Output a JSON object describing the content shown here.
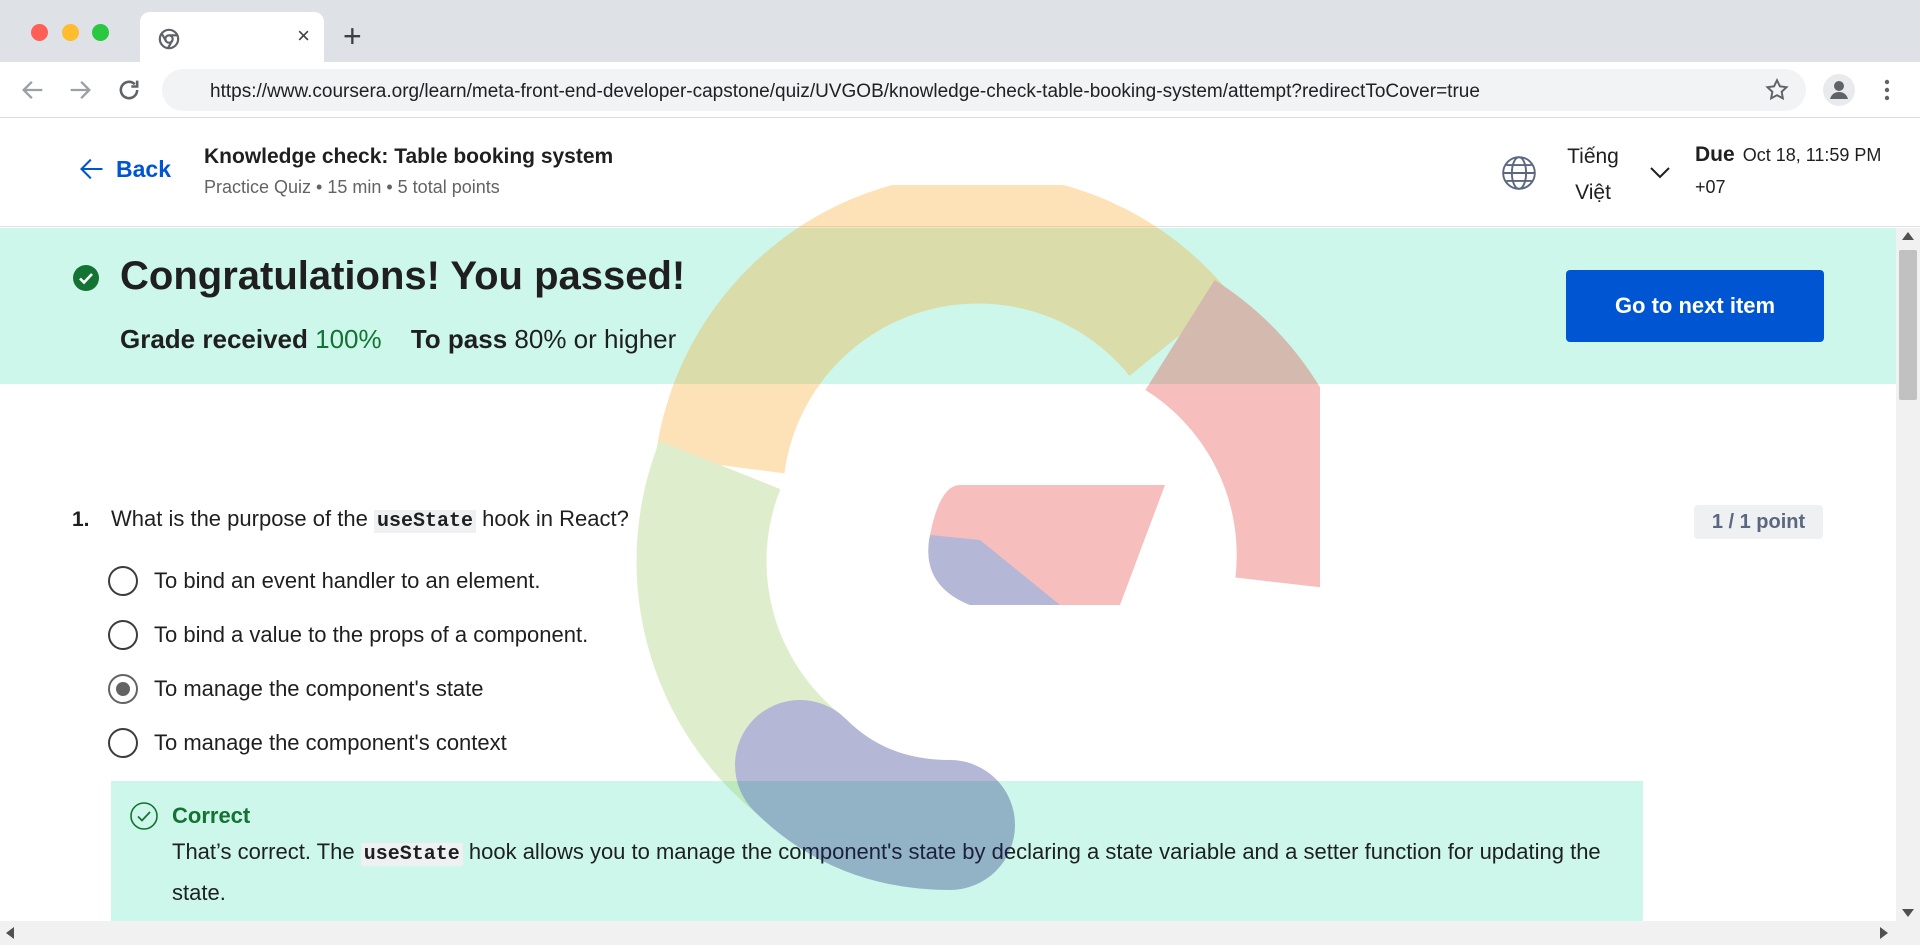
{
  "browser": {
    "tab_close": "×",
    "new_tab": "+",
    "url": "https://www.coursera.org/learn/meta-front-end-developer-capstone/quiz/UVGOB/knowledge-check-table-booking-system/attempt?redirectToCover=true"
  },
  "header": {
    "back_label": "Back",
    "title": "Knowledge check: Table booking system",
    "meta": "Practice Quiz • 15 min • 5 total points",
    "language": "Tiếng Việt",
    "due_label": "Due",
    "due_date": "Oct 18, 11:59 PM",
    "due_tz": "+07"
  },
  "banner": {
    "title": "Congratulations! You passed!",
    "grade_label": "Grade received",
    "grade_value": "100%",
    "pass_label": "To pass",
    "pass_value": "80% or higher",
    "next_button": "Go to next item"
  },
  "question": {
    "number": "1.",
    "text_before": "What is the purpose of the",
    "code": "useState",
    "text_after": "hook in React?",
    "points": "1 / 1 point",
    "options": [
      {
        "label": "To bind an event handler to an element.",
        "selected": false
      },
      {
        "label": "To bind a value to the props of a component.",
        "selected": false
      },
      {
        "label": "To manage the component's state",
        "selected": true
      },
      {
        "label": "To manage the component's context",
        "selected": false
      }
    ],
    "feedback": {
      "title": "Correct",
      "text_before": "That’s correct. The",
      "code": "useState",
      "text_after": "hook allows you to manage the component's state by declaring a state variable and a setter function for updating the state."
    }
  },
  "colors": {
    "brand_blue": "#0056d2",
    "success_green": "#137333",
    "banner_mint": "#ccf7ea"
  },
  "icons": [
    "chrome-icon",
    "back-arrow-icon",
    "forward-arrow-icon",
    "reload-icon",
    "star-icon",
    "profile-icon",
    "menu-icon",
    "globe-icon",
    "chevron-down-icon",
    "check-circle-icon",
    "check-outline-icon"
  ]
}
